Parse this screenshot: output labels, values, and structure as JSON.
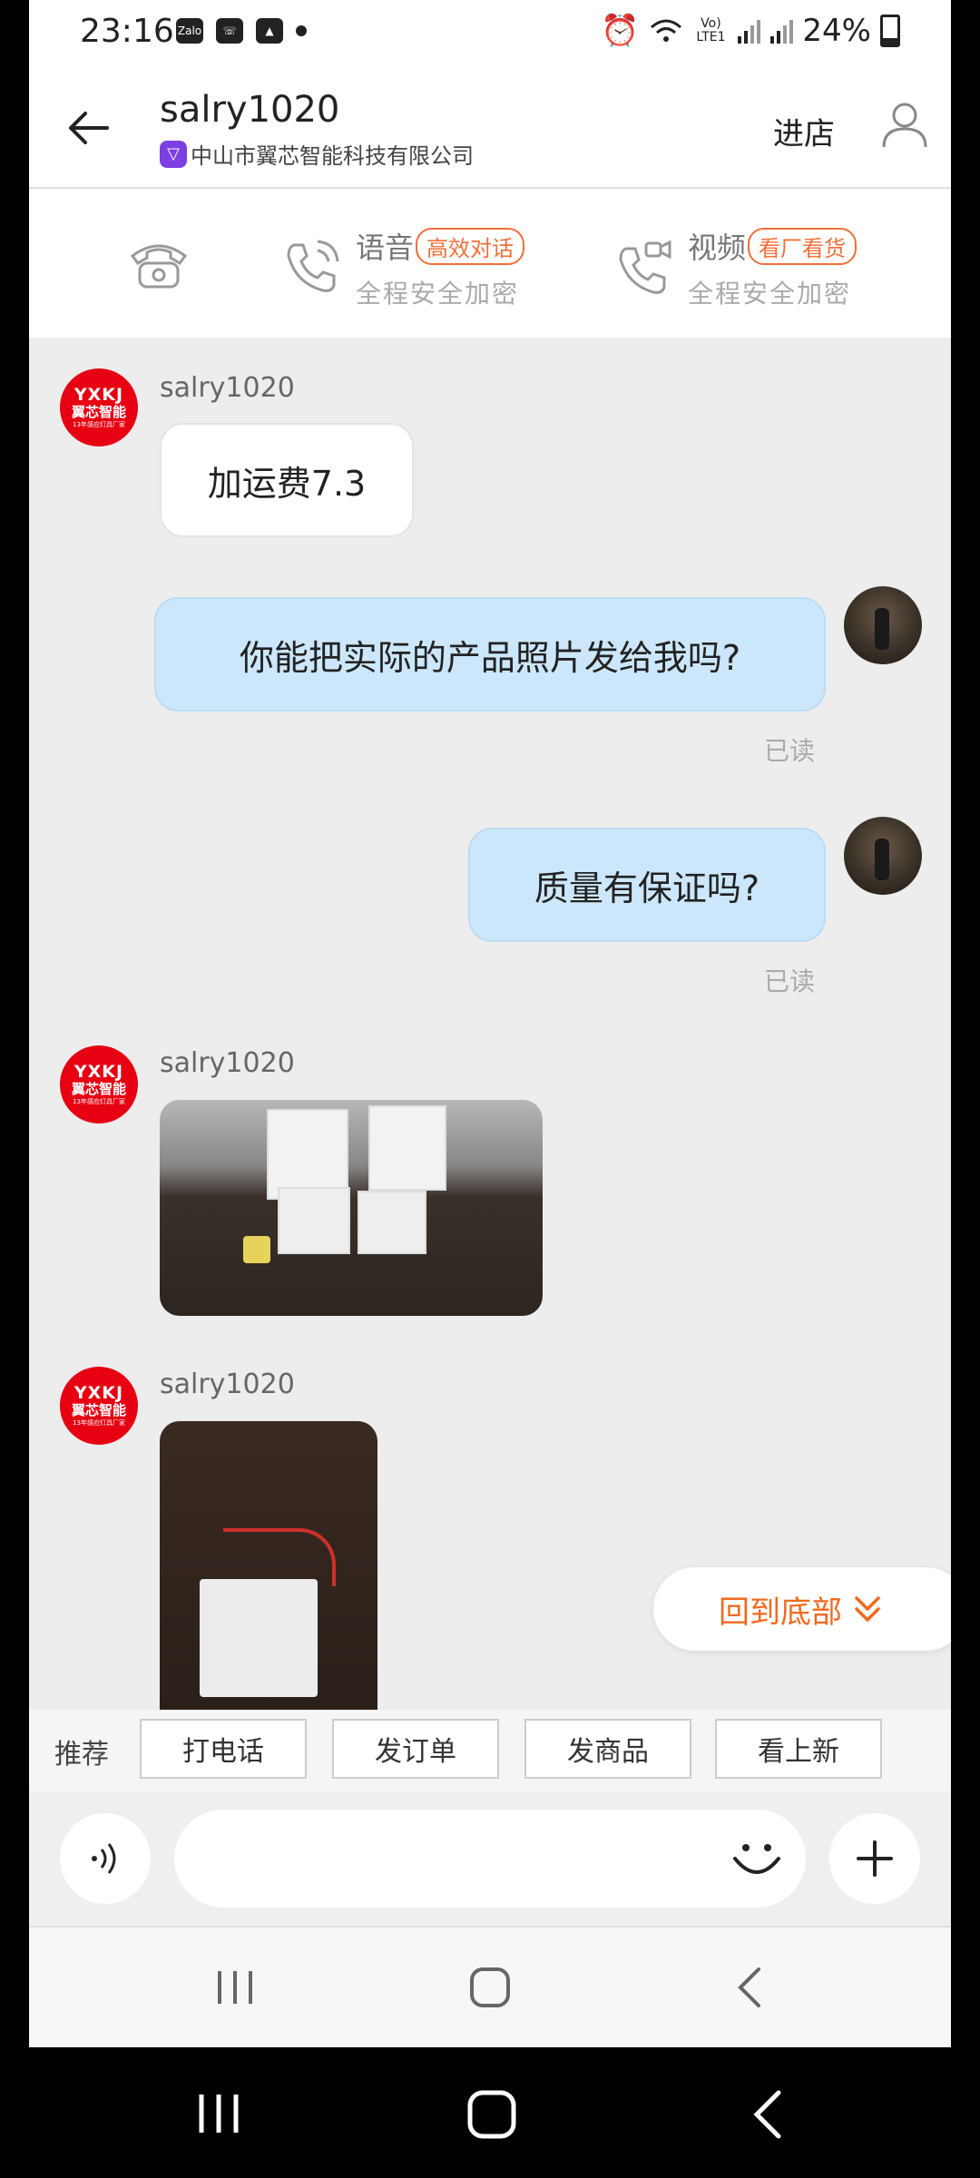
{
  "status_bar": {
    "time": "23:16",
    "app_icons": [
      "zalo-icon",
      "missed-call-icon",
      "gallery-icon"
    ],
    "zalo_label": "Zalo",
    "network_label": "Vo) LTE1",
    "battery": "24%"
  },
  "header": {
    "title": "salry1020",
    "company": "中山市翼芯智能科技有限公司",
    "enter_shop": "进店"
  },
  "call_bar": {
    "voice_title": "语音",
    "voice_tag": "高效对话",
    "voice_sub": "全程安全加密",
    "video_title": "视频",
    "video_tag": "看厂看货",
    "video_sub": "全程安全加密"
  },
  "avatar": {
    "brand": "YXKJ",
    "name": "翼芯智能",
    "slogan": "13年感应灯具厂家"
  },
  "messages": [
    {
      "sender": "salry1020",
      "text": "加运费7.3"
    },
    {
      "text": "你能把实际的产品照片发给我吗?",
      "status": "已读"
    },
    {
      "text": "质量有保证吗?",
      "status": "已读"
    },
    {
      "sender": "salry1020"
    },
    {
      "sender": "salry1020"
    }
  ],
  "back_to_bottom": "回到底部",
  "quick_actions": {
    "label": "推荐",
    "buttons": [
      "打电话",
      "发订单",
      "发商品",
      "看上新"
    ]
  },
  "input": {
    "placeholder": ""
  },
  "colors": {
    "accent_orange": "#f06a1f",
    "bubble_blue": "#cce7fb",
    "brand_red": "#e60012",
    "badge_purple": "#7b3fe4"
  }
}
